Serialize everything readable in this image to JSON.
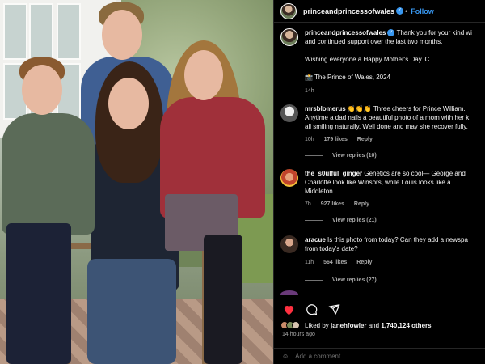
{
  "post": {
    "username": "princeandprincessofwales",
    "follow_label": "Follow",
    "dot": "•",
    "caption_line1": "Thank you for your kind wi",
    "caption_line2": "and continued support over the last two months.",
    "caption_line3": "Wishing everyone a Happy Mother's Day. C",
    "caption_line4": "📸 The Prince of Wales, 2024",
    "caption_age": "14h"
  },
  "comments": [
    {
      "username": "mrsblomerus",
      "line1": "👏👏👏 Three cheers for Prince William.",
      "line2": "Anytime a dad nails a beautiful photo of a mom with her k",
      "line3": "all smiling naturally. Well done and may she recover fully.",
      "age": "10h",
      "likes": "179 likes",
      "reply_label": "Reply",
      "view_replies": "View replies (10)"
    },
    {
      "username": "the_s0ulful_ginger",
      "line1": "Genetics are so cool— George and",
      "line2": "Charlotte look like Winsors, while Louis looks like a",
      "line3": "Middleton",
      "age": "7h",
      "likes": "927 likes",
      "reply_label": "Reply",
      "view_replies": "View replies (21)"
    },
    {
      "username": "aracue",
      "line1": "Is this photo from today? Can they add a newspa",
      "line2": "from today's date?",
      "age": "11h",
      "likes": "564 likes",
      "reply_label": "Reply",
      "view_replies": "View replies (27)"
    }
  ],
  "footer": {
    "liked_prefix": "Liked by",
    "liked_user": "janehfowler",
    "liked_and": "and",
    "liked_count": "1,740,124 others",
    "time_ago": "14 hours ago",
    "add_comment_placeholder": "Add a comment..."
  },
  "icons": {
    "heart": "heart-icon",
    "comment": "comment-icon",
    "share": "share-icon"
  },
  "colors": {
    "link_blue": "#3897f0",
    "heart_red": "#ff3040",
    "muted": "#a8a8a8"
  }
}
